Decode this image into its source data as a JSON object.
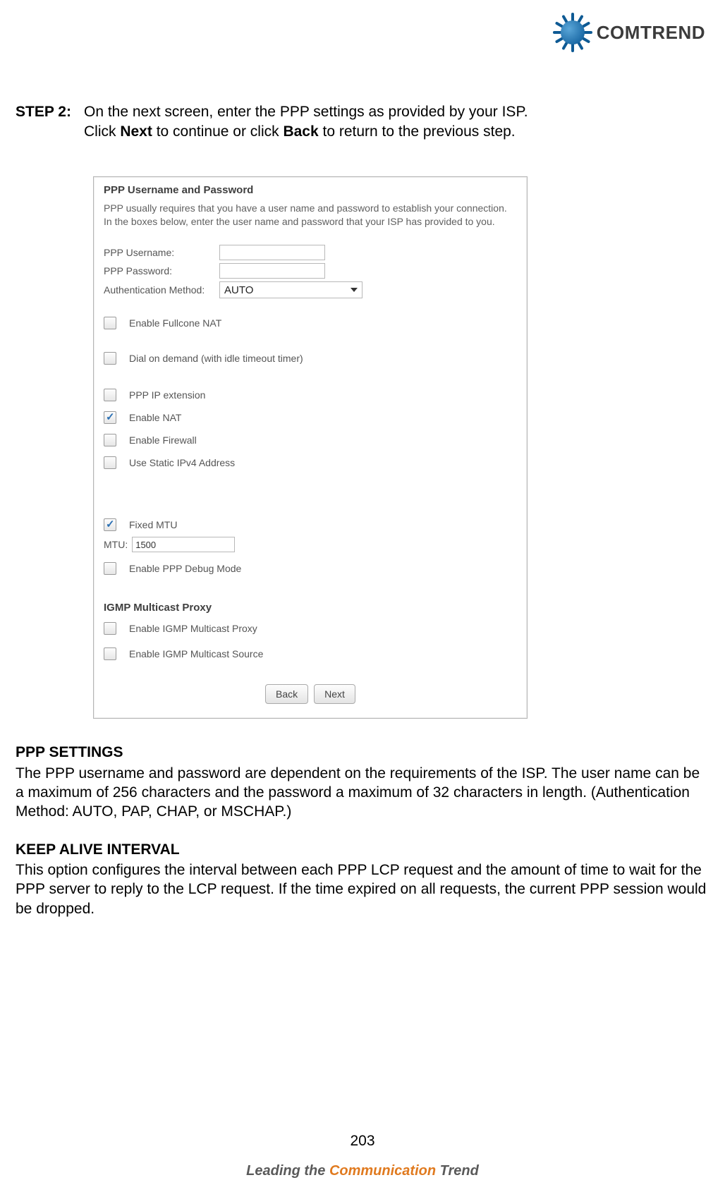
{
  "brand": {
    "name": "COMTREND"
  },
  "step": {
    "label": "STEP 2:",
    "line1a": "On the next screen, enter the PPP settings as provided by your ISP.",
    "line2a": "Click ",
    "line2b": "Next",
    "line2c": " to continue or click ",
    "line2d": "Back",
    "line2e": " to return to the previous step."
  },
  "dialog": {
    "title": "PPP Username and Password",
    "desc": "PPP usually requires that you have a user name and password to establish your connection. In the boxes below, enter the user name and password that your ISP has provided to you.",
    "fields": {
      "username_label": "PPP Username:",
      "password_label": "PPP Password:",
      "auth_label": "Authentication Method:",
      "auth_value": "AUTO"
    },
    "opts": {
      "fullcone": "Enable Fullcone NAT",
      "dialod": "Dial on demand (with idle timeout timer)",
      "ipext": "PPP IP extension",
      "nat": "Enable NAT",
      "firewall": "Enable Firewall",
      "staticip": "Use Static IPv4 Address",
      "fixedmtu": "Fixed MTU",
      "mtu_label": "MTU:",
      "mtu_value": "1500",
      "debug": "Enable PPP Debug Mode"
    },
    "igmp": {
      "title": "IGMP Multicast Proxy",
      "proxy": "Enable IGMP Multicast Proxy",
      "source": "Enable IGMP Multicast Source"
    },
    "buttons": {
      "back": "Back",
      "next": "Next"
    }
  },
  "sections": {
    "ppp_title": "PPP SETTINGS",
    "ppp_body": "The PPP username and password are dependent on the requirements of the ISP. The user name can be a maximum of 256 characters and the password a maximum of 32 characters in length. (Authentication Method: AUTO, PAP, CHAP, or MSCHAP.)",
    "keep_title": "KEEP ALIVE INTERVAL",
    "keep_body": "This option configures the interval between each PPP LCP request and the amount of time to wait for the PPP server to reply to the LCP request.   If the time expired on all requests, the current PPP session would be dropped."
  },
  "page_number": "203",
  "tagline": {
    "a": "Leading the ",
    "b": "Communication",
    "c": " Trend"
  }
}
